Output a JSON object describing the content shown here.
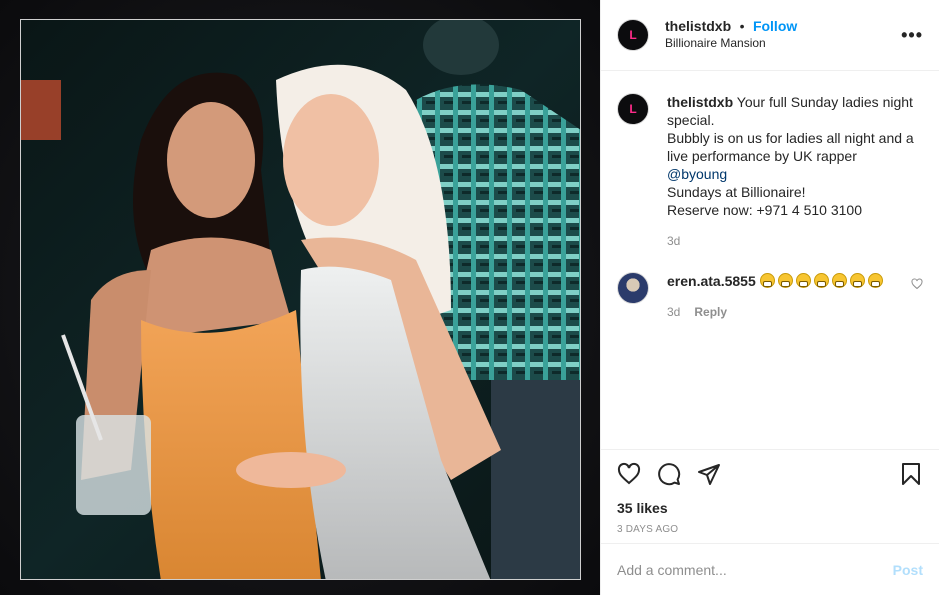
{
  "post": {
    "username": "thelistdxb",
    "dot": "•",
    "follow_label": "Follow",
    "location": "Billionaire Mansion",
    "more_label": "•••",
    "avatar_initials": "L"
  },
  "caption": {
    "username": "thelistdxb",
    "line1": " Your full Sunday ladies night special.",
    "line2": "Bubbly is on us for ladies all night and a live performance by UK rapper",
    "mention": "@byoung",
    "line3": "Sundays at Billionaire!",
    "line4": "Reserve now: +971 4 510 3100",
    "time": "3d"
  },
  "comments": [
    {
      "username": "eren.ata.5855",
      "emoji_count": 7,
      "time": "3d",
      "reply_label": "Reply"
    }
  ],
  "actions": {
    "likes": "35 likes",
    "time_ago": "3 DAYS AGO"
  },
  "add_comment": {
    "placeholder": "Add a comment...",
    "post_label": "Post"
  },
  "icons": [
    "heart-icon",
    "comment-icon",
    "share-icon",
    "bookmark-icon",
    "more-icon",
    "like-comment-icon"
  ],
  "colors": {
    "follow": "#0095f6",
    "post_disabled": "#b2dffc",
    "muted": "#8e8e8e",
    "mention": "#00376b"
  }
}
